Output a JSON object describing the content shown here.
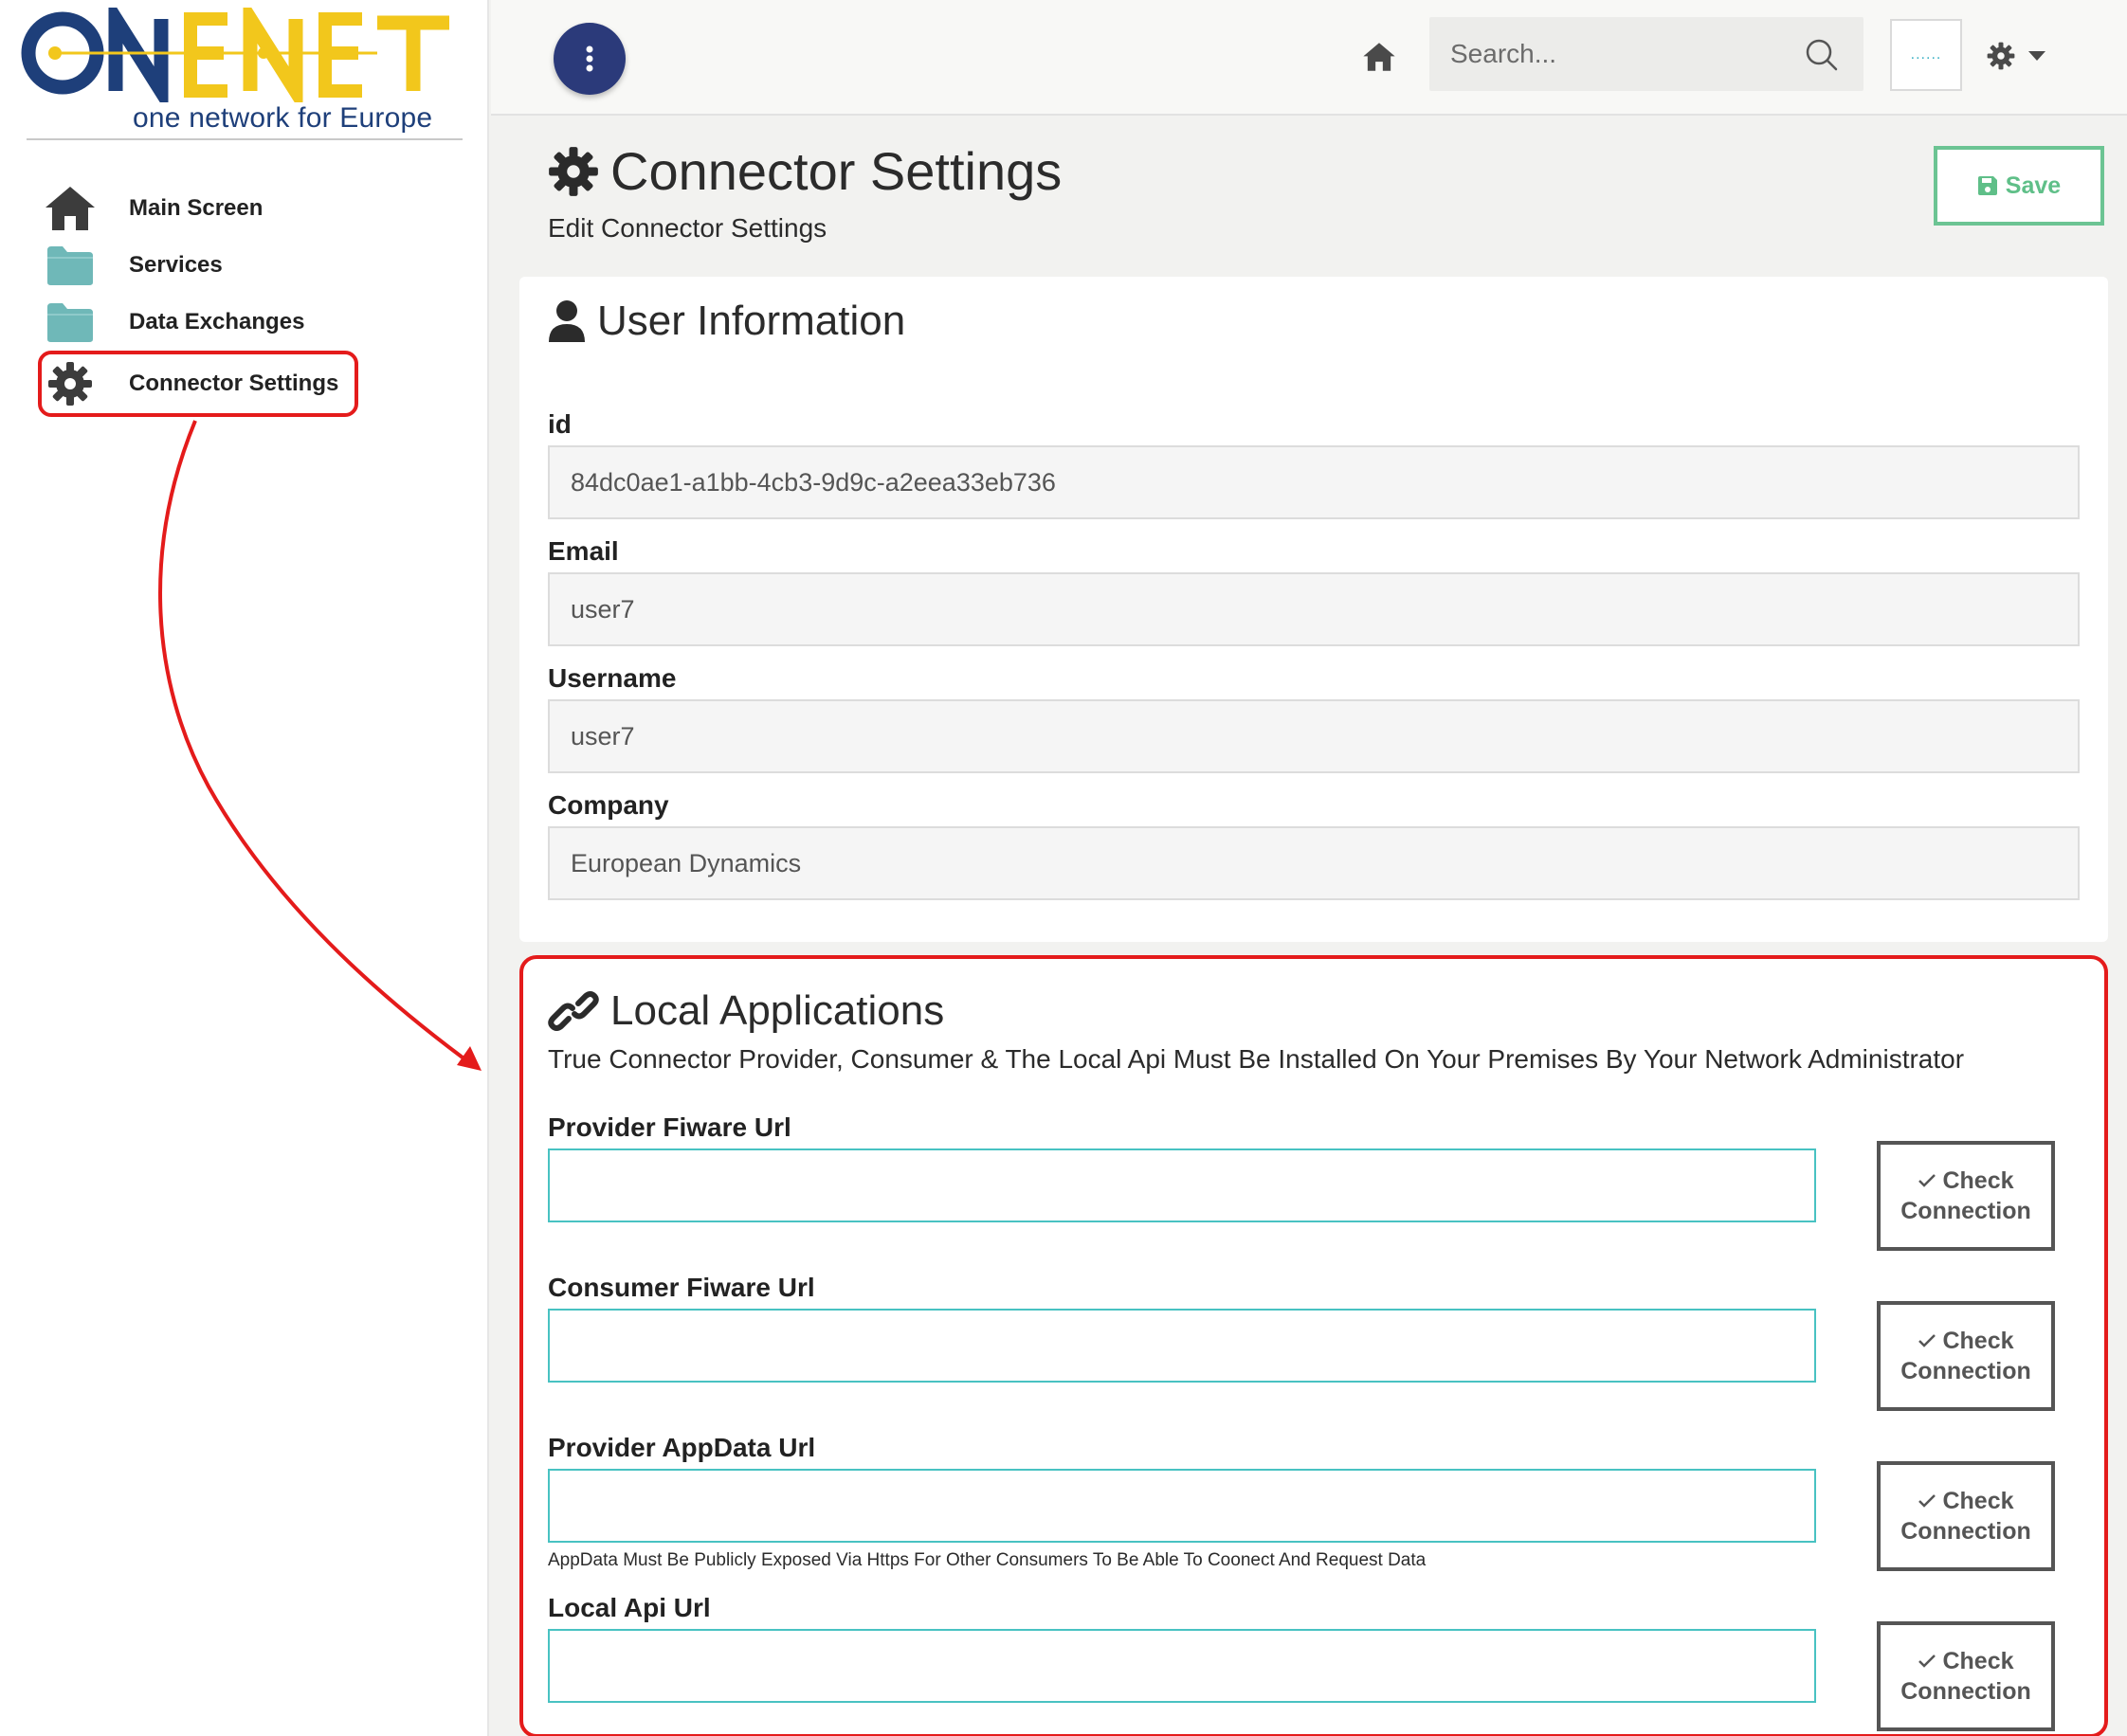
{
  "sidebar": {
    "logo_text": "ONENET",
    "logo_tagline": "one network for Europe",
    "items": [
      {
        "label": "Main Screen",
        "icon": "home-icon"
      },
      {
        "label": "Services",
        "icon": "folder-icon"
      },
      {
        "label": "Data Exchanges",
        "icon": "folder-icon"
      },
      {
        "label": "Connector Settings",
        "icon": "gear-icon",
        "active": true
      }
    ]
  },
  "topbar": {
    "search_placeholder": "Search...",
    "dots_label": "......"
  },
  "page": {
    "title": "Connector Settings",
    "subtitle": "Edit Connector Settings",
    "save_label": "Save"
  },
  "user_info": {
    "title": "User Information",
    "fields": [
      {
        "label": "id",
        "value": "84dc0ae1-a1bb-4cb3-9d9c-a2eea33eb736"
      },
      {
        "label": "Email",
        "value": "user7"
      },
      {
        "label": "Username",
        "value": "user7"
      },
      {
        "label": "Company",
        "value": "European Dynamics"
      }
    ]
  },
  "local_apps": {
    "title": "Local Applications",
    "description": "True Connector Provider, Consumer & The Local Api Must Be Installed On Your Premises By Your Network Administrator",
    "check_line1": "Check",
    "check_line2": "Connection",
    "fields": [
      {
        "label": "Provider Fiware Url",
        "value": ""
      },
      {
        "label": "Consumer Fiware Url",
        "value": ""
      },
      {
        "label": "Provider AppData Url",
        "value": "",
        "hint": "AppData Must Be Publicly Exposed Via Https For Other Consumers To Be Able To Coonect And Request Data"
      },
      {
        "label": "Local Api Url",
        "value": ""
      }
    ]
  },
  "colors": {
    "brand_blue": "#1e3f7a",
    "brand_yellow": "#f2c71c",
    "annotation_red": "#e41b1b",
    "save_green": "#5fbf88",
    "input_teal": "#48c2c2",
    "menu_button": "#2b3a7a"
  }
}
